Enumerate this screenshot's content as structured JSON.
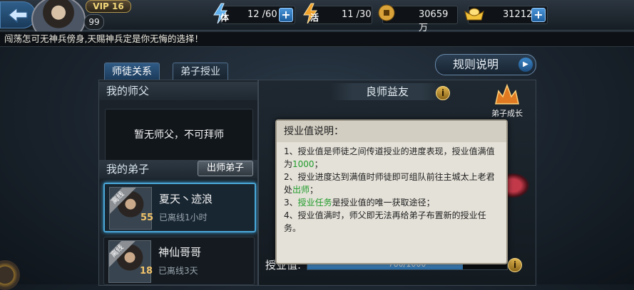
{
  "header": {
    "vip_label": "VIP 16",
    "level": "99",
    "stamina_label": "体",
    "stamina": "12 /60",
    "vitality_label": "活",
    "vitality": "11 /30",
    "copper": "30659万",
    "gold": "31212",
    "plus": "+"
  },
  "ticker": "闯荡怎可无神兵傍身,天赐神兵定是你无悔的选择！",
  "tabs": [
    {
      "label": "师徒关系",
      "active": true
    },
    {
      "label": "弟子授业",
      "active": false
    }
  ],
  "rules_button": "规则说明",
  "left": {
    "master_title": "我的师父",
    "master_empty": "暂无师父，不可拜师",
    "disciples_title": "我的弟子",
    "expel_button": "出师弟子",
    "disciples": [
      {
        "name": "夏天丶迹浪",
        "level": "55",
        "status": "已离线1小时",
        "tag": "离线"
      },
      {
        "name": "神仙哥哥",
        "level": "18",
        "status": "已离线3天",
        "tag": "离线"
      }
    ]
  },
  "right": {
    "title": "良师益友",
    "growth_label": "弟子成长",
    "bar_label": "授业值:",
    "bar_text": "780/1000",
    "bar_value": 780,
    "bar_max": 1000
  },
  "tooltip": {
    "title": "授业值说明：",
    "l1a": "1、授业值是师徒之间传道授业的进度表现，授业值满值为",
    "l1b": "1000",
    "l1c": "；",
    "l2a": "2、授业进度达到满值时师徒即可组队前往主城太上老君处",
    "l2b": "出师",
    "l2c": "；",
    "l3a": "3、",
    "l3b": "授业任务",
    "l3c": "是授业值的唯一获取途径；",
    "l4": "4、授业值满时，师父即无法再给弟子布置新的授业任务。"
  },
  "colors": {
    "accent_blue": "#2f5a84",
    "highlight_green": "#1e9b2a",
    "gold": "#f2d77a"
  }
}
